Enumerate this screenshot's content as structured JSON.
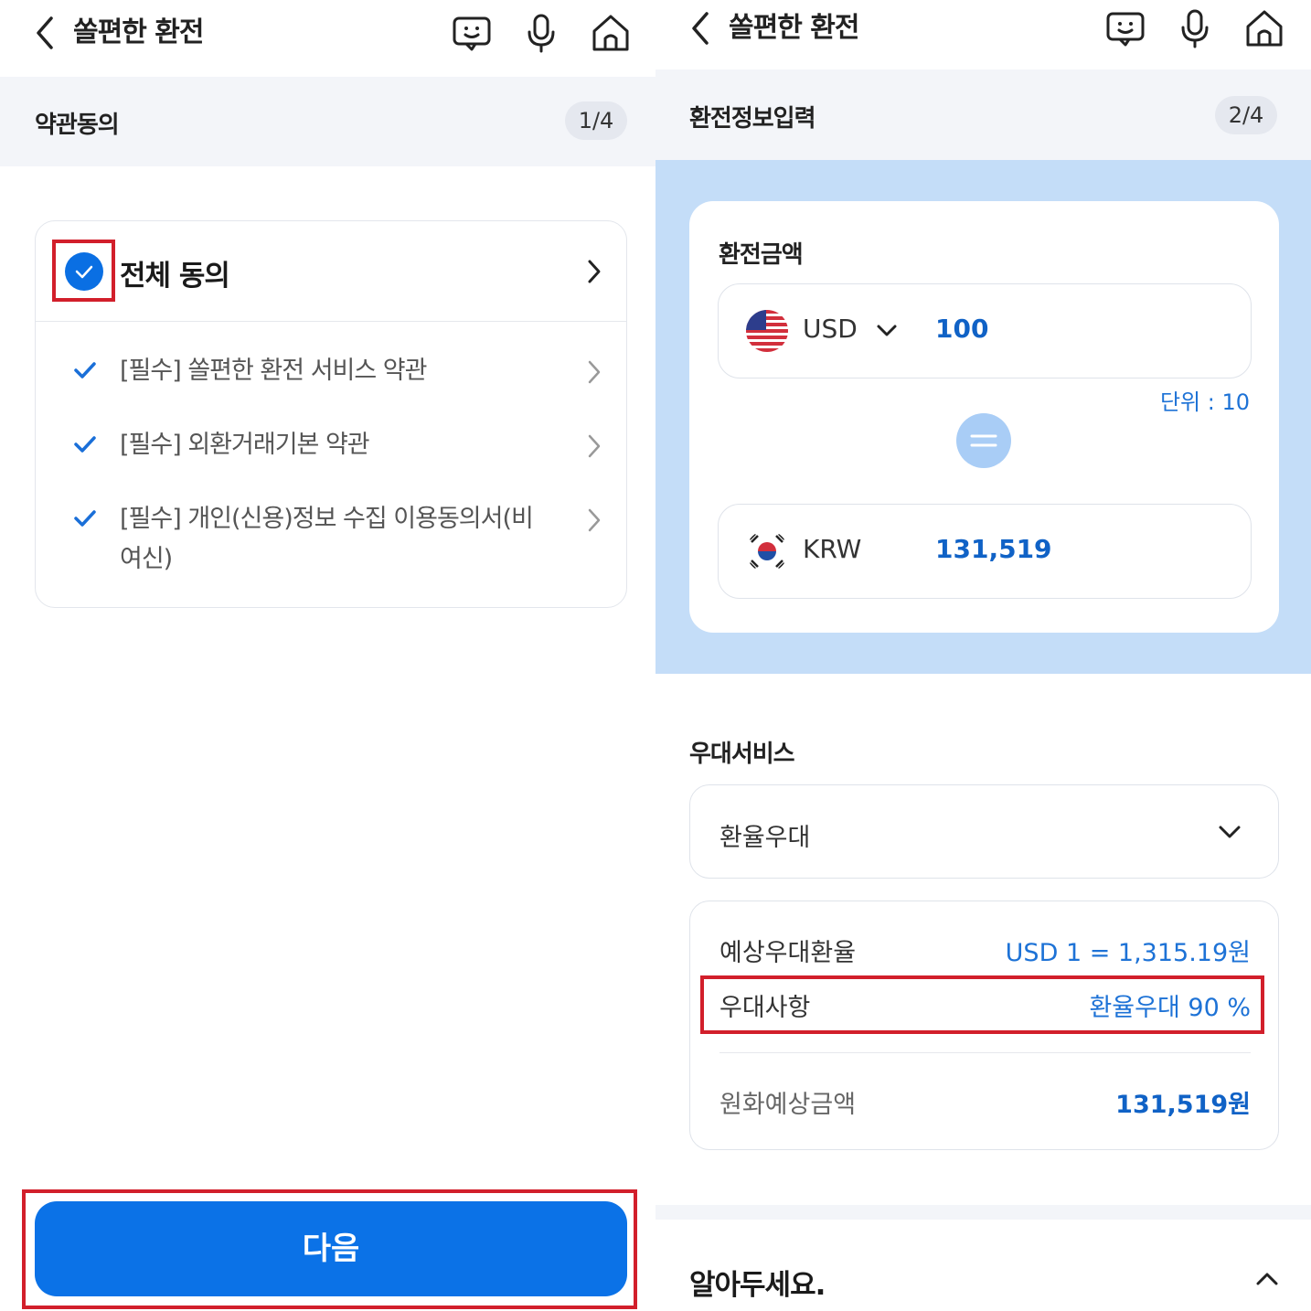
{
  "left": {
    "header": {
      "title": "쏠편한 환전"
    },
    "step": {
      "title": "약관동의",
      "counter": "1/4"
    },
    "agree_all": {
      "label": "전체 동의",
      "checked": true
    },
    "terms": [
      {
        "label": "[필수] 쏠편한 환전 서비스 약관"
      },
      {
        "label": "[필수] 외환거래기본 약관"
      },
      {
        "label": "[필수] 개인(신용)정보 수집 이용동의서(비여신)"
      }
    ],
    "next_button": "다음"
  },
  "right": {
    "header": {
      "title": "쏠편한 환전"
    },
    "step": {
      "title": "환전정보입력",
      "counter": "2/4"
    },
    "amount": {
      "title": "환전금액",
      "from": {
        "code": "USD",
        "value": "100",
        "flag": "us-flag-icon"
      },
      "unit": "단위 : 10",
      "to": {
        "code": "KRW",
        "value": "131,519",
        "flag": "kr-flag-icon"
      }
    },
    "benefit": {
      "title": "우대서비스",
      "selected": "환율우대",
      "rows": [
        {
          "label": "예상우대환율",
          "value": "USD 1 = 1,315.19원"
        },
        {
          "label": "우대사항",
          "value": "환율우대 90 %"
        },
        {
          "label": "원화예상금액",
          "value": "131,519원"
        }
      ]
    },
    "notice": {
      "title": "알아두세요."
    }
  },
  "colors": {
    "primary": "#0b72e7",
    "accent_blue": "#1d72d6",
    "highlight": "#d21f2b",
    "section_bg": "#c4ddf8"
  }
}
